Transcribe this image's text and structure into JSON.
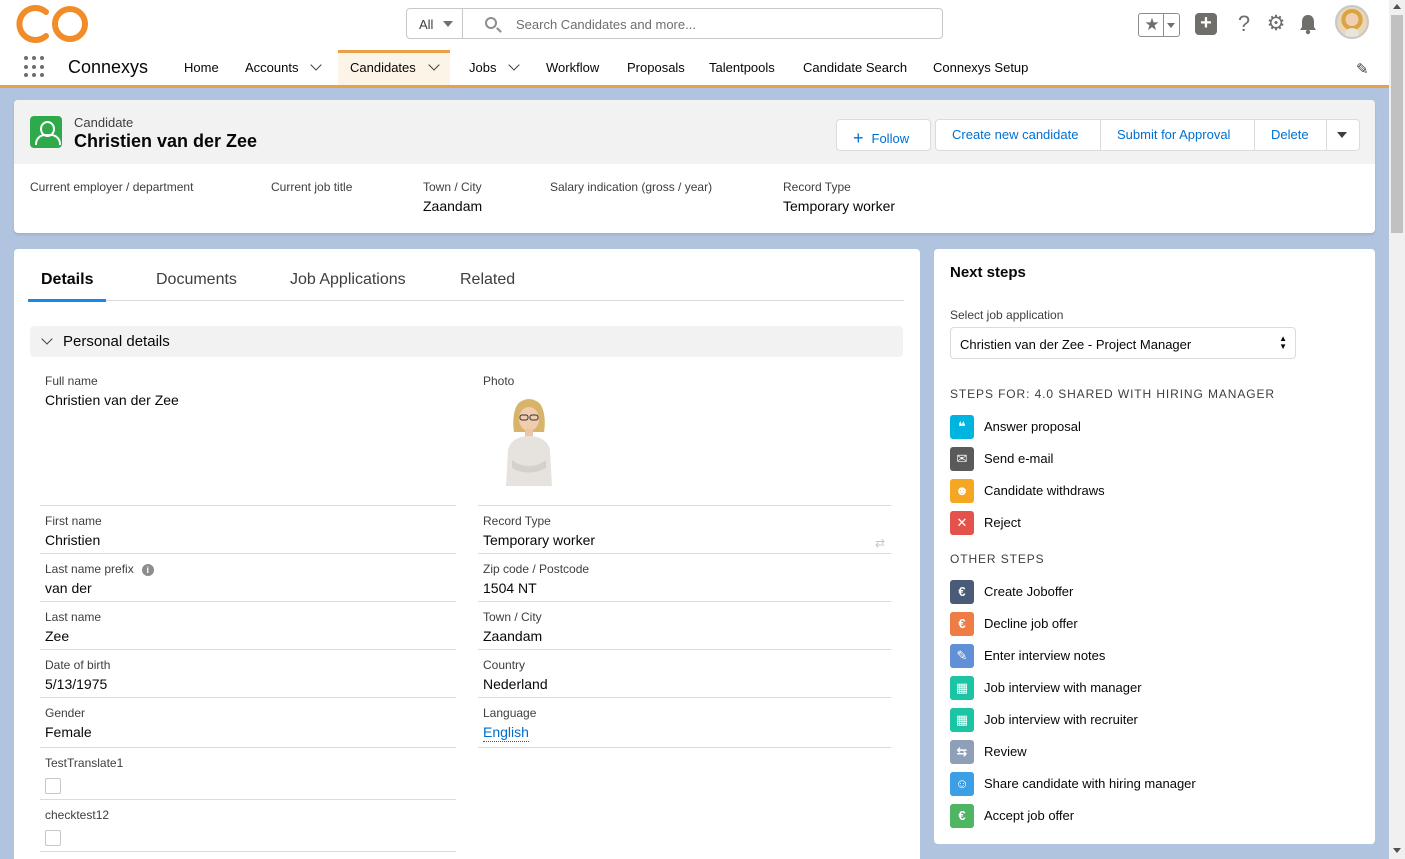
{
  "header": {
    "search_scope": "All",
    "search_placeholder": "Search Candidates and more...",
    "icons": [
      "star-icon",
      "add-icon",
      "help-icon",
      "gear-icon",
      "bell-icon"
    ]
  },
  "nav": {
    "app_name": "Connexys",
    "items": [
      {
        "label": "Home"
      },
      {
        "label": "Accounts"
      },
      {
        "label": "Candidates"
      },
      {
        "label": "Jobs"
      },
      {
        "label": "Workflow"
      },
      {
        "label": "Proposals"
      },
      {
        "label": "Talentpools"
      },
      {
        "label": "Candidate Search"
      },
      {
        "label": "Connexys Setup"
      }
    ]
  },
  "record": {
    "type": "Candidate",
    "name": "Christien van der Zee",
    "actions": {
      "follow": "Follow",
      "create": "Create new candidate",
      "submit": "Submit for Approval",
      "delete": "Delete"
    },
    "highlights": [
      {
        "label": "Current employer / department",
        "value": ""
      },
      {
        "label": "Current job title",
        "value": ""
      },
      {
        "label": "Town / City",
        "value": "Zaandam"
      },
      {
        "label": "Salary indication (gross / year)",
        "value": ""
      },
      {
        "label": "Record Type",
        "value": "Temporary worker"
      }
    ]
  },
  "tabs": [
    "Details",
    "Documents",
    "Job Applications",
    "Related"
  ],
  "section": {
    "title": "Personal details",
    "left": [
      {
        "label": "Full name",
        "value": "Christien van der Zee"
      },
      {
        "label": "First name",
        "value": "Christien"
      },
      {
        "label": "Last name prefix",
        "value": "van der"
      },
      {
        "label": "Last name",
        "value": "Zee"
      },
      {
        "label": "Date of birth",
        "value": "5/13/1975"
      },
      {
        "label": "Gender",
        "value": "Female"
      },
      {
        "label": "TestTranslate1",
        "value": ""
      },
      {
        "label": "checktest12",
        "value": ""
      }
    ],
    "right": [
      {
        "label": "Photo",
        "value": ""
      },
      {
        "label": "Record Type",
        "value": "Temporary worker"
      },
      {
        "label": "Zip code / Postcode",
        "value": "1504 NT"
      },
      {
        "label": "Town / City",
        "value": "Zaandam"
      },
      {
        "label": "Country",
        "value": "Nederland"
      },
      {
        "label": "Language",
        "value": "English"
      }
    ]
  },
  "next_steps": {
    "title": "Next steps",
    "select_label": "Select job application",
    "selected": "Christien van der Zee - Project Manager",
    "steps_heading": "STEPS FOR: 4.0 SHARED WITH HIRING MANAGER",
    "steps": [
      {
        "label": "Answer proposal",
        "color": "#00b4e0"
      },
      {
        "label": "Send e-mail",
        "color": "#5a5a5a"
      },
      {
        "label": "Candidate withdraws",
        "color": "#f5a623"
      },
      {
        "label": "Reject",
        "color": "#e4534b"
      }
    ],
    "other_heading": "OTHER STEPS",
    "other": [
      {
        "label": "Create Joboffer",
        "color": "#4a5b77"
      },
      {
        "label": "Decline job offer",
        "color": "#ef7b45"
      },
      {
        "label": "Enter interview notes",
        "color": "#6290d6"
      },
      {
        "label": "Job interview with manager",
        "color": "#1cc3a4"
      },
      {
        "label": "Job interview with recruiter",
        "color": "#1cc3a4"
      },
      {
        "label": "Review",
        "color": "#8e9fb7"
      },
      {
        "label": "Share candidate with hiring manager",
        "color": "#3c9ee5"
      },
      {
        "label": "Accept job offer",
        "color": "#4eb562"
      }
    ]
  }
}
